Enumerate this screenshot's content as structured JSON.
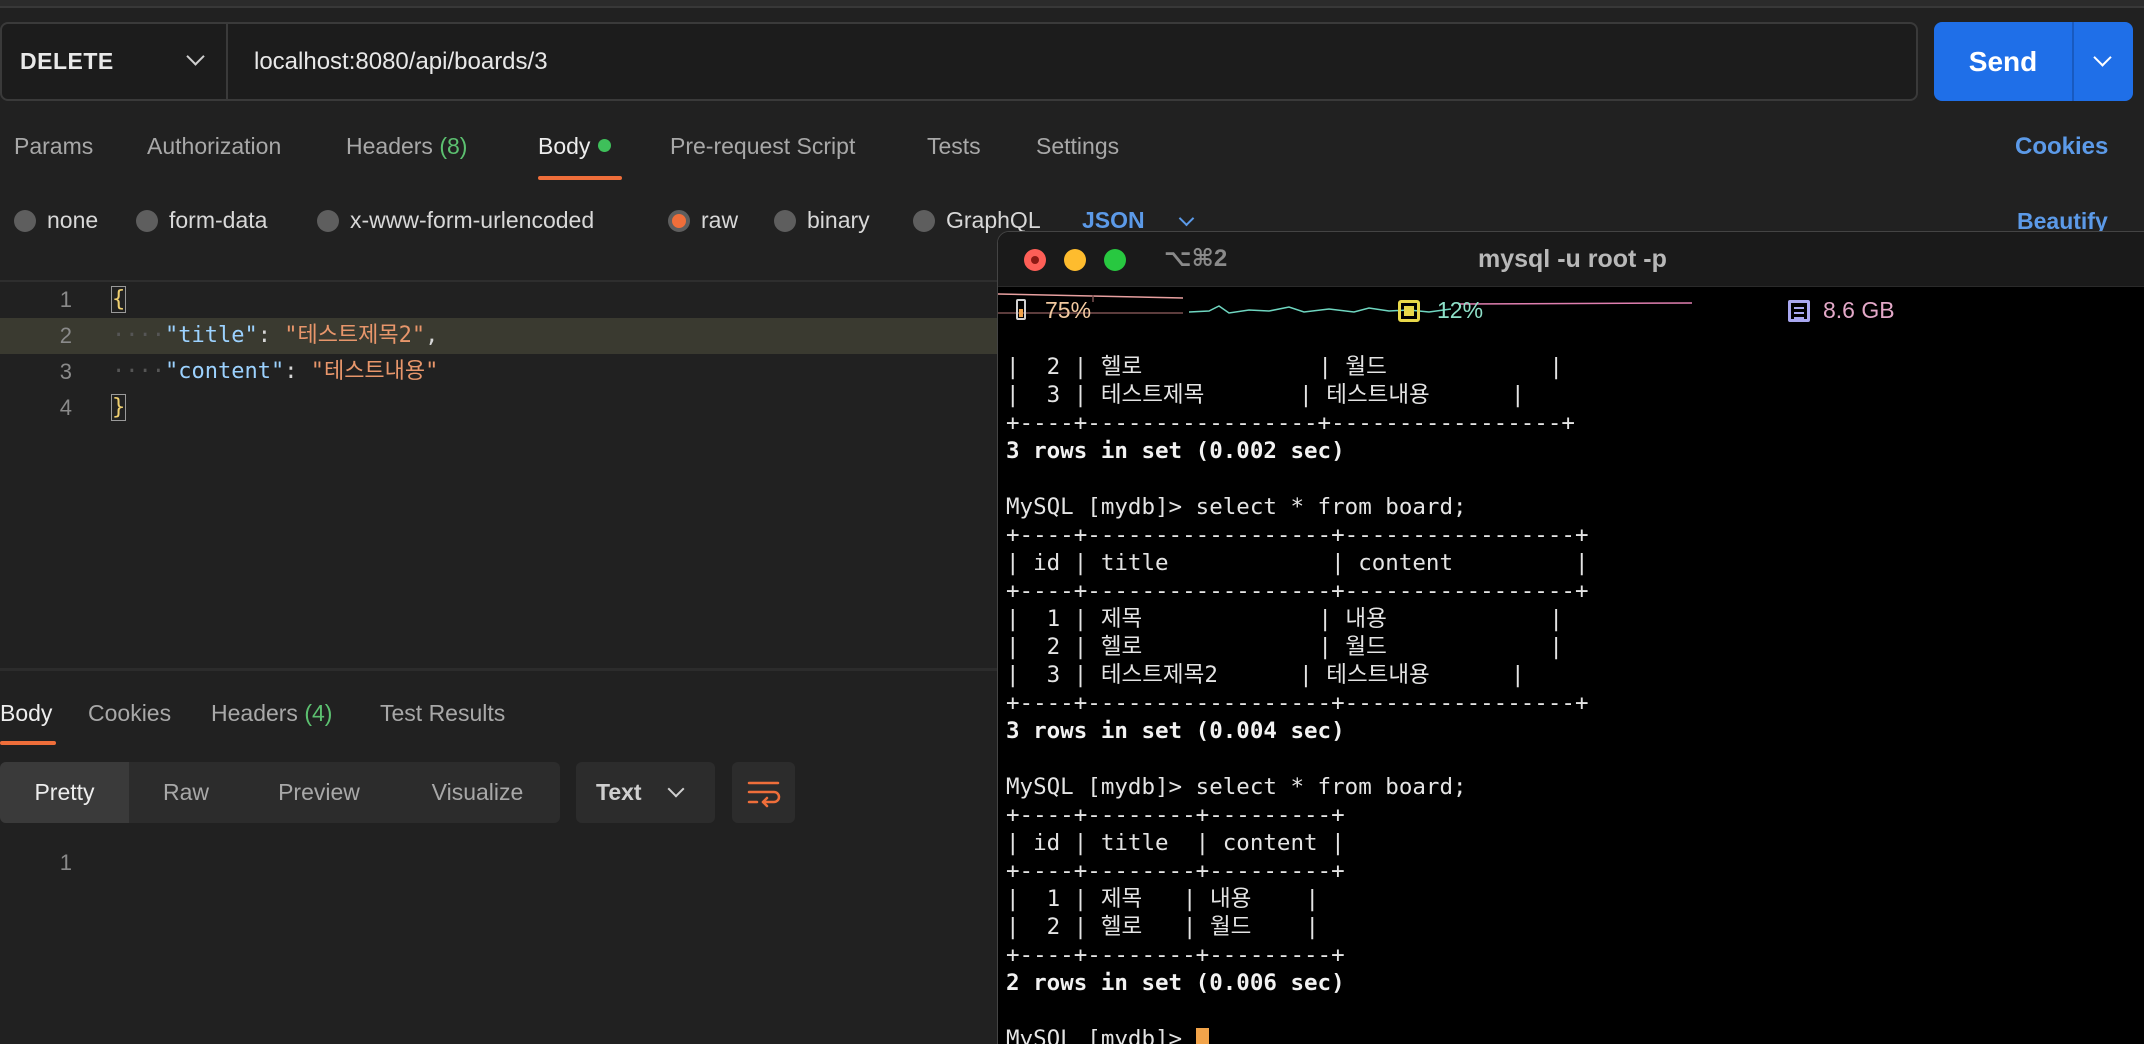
{
  "request": {
    "method": "DELETE",
    "url": "localhost:8080/api/boards/3",
    "send_label": "Send"
  },
  "request_tabs": {
    "params": "Params",
    "authorization": "Authorization",
    "headers_label": "Headers",
    "headers_count": "(8)",
    "body": "Body",
    "pre_request": "Pre-request Script",
    "tests": "Tests",
    "settings": "Settings",
    "cookies": "Cookies"
  },
  "body_types": {
    "none": "none",
    "form_data": "form-data",
    "urlencoded": "x-www-form-urlencoded",
    "raw": "raw",
    "binary": "binary",
    "graphql": "GraphQL",
    "selected": "raw",
    "format": "JSON",
    "beautify": "Beautify"
  },
  "editor": {
    "line_numbers": [
      "1",
      "2",
      "3",
      "4"
    ],
    "open_brace": "{",
    "close_brace": "}",
    "indent": "····",
    "key1": "\"title\"",
    "val1": "\"테스트제목2\"",
    "key2": "\"content\"",
    "val2": "\"테스트내용\"",
    "colon": ": ",
    "comma": ","
  },
  "response_tabs": {
    "body": "Body",
    "cookies": "Cookies",
    "headers_label": "Headers",
    "headers_count": "(4)",
    "test_results": "Test Results"
  },
  "response_view": {
    "pretty": "Pretty",
    "raw": "Raw",
    "preview": "Preview",
    "visualize": "Visualize",
    "format": "Text",
    "line_number": "1"
  },
  "terminal": {
    "tab_shortcut": "⌥⌘2",
    "title": "mysql -u root -p",
    "battery": "75%",
    "cpu": "12%",
    "memory": "8.6 GB",
    "colors": {
      "battery_graph": "#e8a0a0",
      "cpu_graph": "#6fd6c0",
      "memory_graph": "#e07fb0",
      "cursor": "#f2a44a"
    },
    "output": [
      "|  2 | 헬로             | 월드            |",
      "|  3 | 테스트제목       | 테스트내용      |",
      "+----+-----------------+-----------------+",
      "3 rows in set (0.002 sec)",
      "",
      "MySQL [mydb]> select * from board;",
      "+----+------------------+-----------------+",
      "| id | title            | content         |",
      "+----+------------------+-----------------+",
      "|  1 | 제목             | 내용            |",
      "|  2 | 헬로             | 월드            |",
      "|  3 | 테스트제목2      | 테스트내용      |",
      "+----+------------------+-----------------+",
      "3 rows in set (0.004 sec)",
      "",
      "MySQL [mydb]> select * from board;",
      "+----+--------+---------+",
      "| id | title  | content |",
      "+----+--------+---------+",
      "|  1 | 제목   | 내용    |",
      "|  2 | 헬로   | 월드    |",
      "+----+--------+---------+",
      "2 rows in set (0.006 sec)",
      "",
      "MySQL [mydb]> "
    ]
  }
}
